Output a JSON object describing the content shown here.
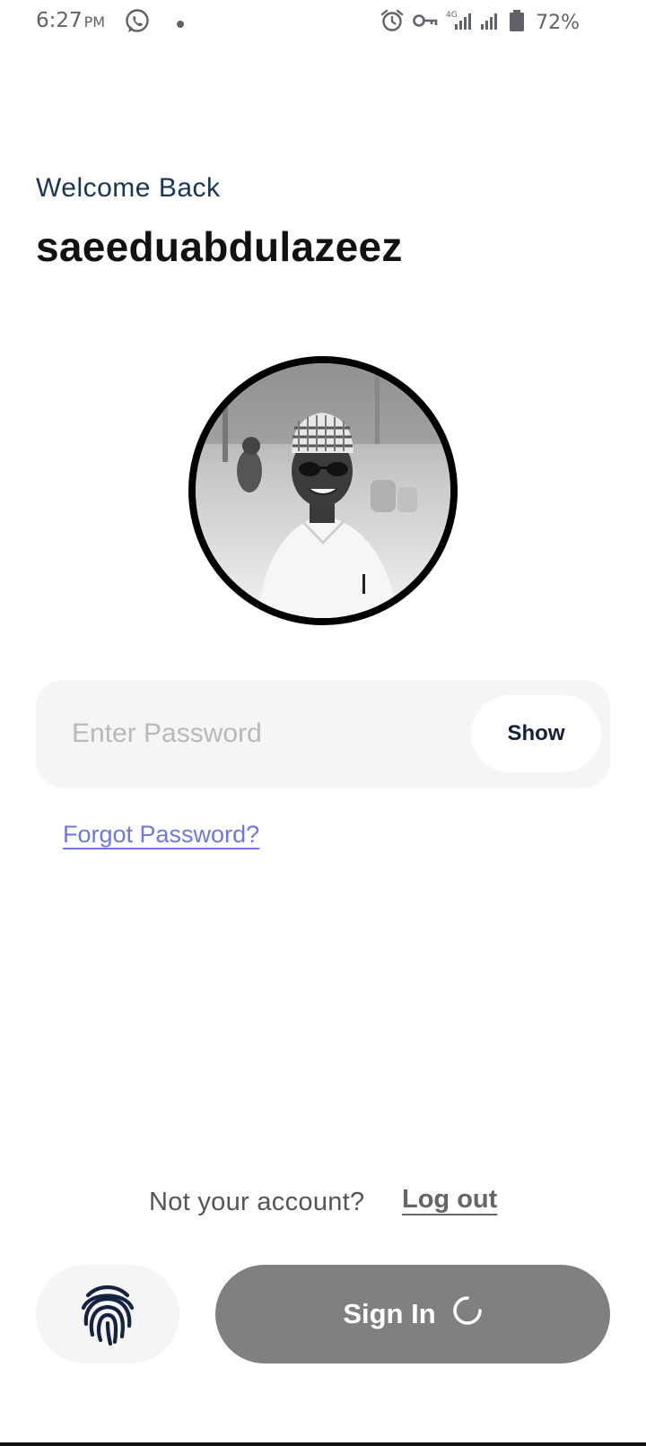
{
  "status_bar": {
    "time": "6:27",
    "ampm": "PM",
    "network": "4G",
    "battery": "72%",
    "icons": [
      "whatsapp-icon",
      "dot-icon",
      "alarm-icon",
      "vpn-key-icon",
      "signal-icon",
      "signal-icon",
      "battery-icon"
    ]
  },
  "header": {
    "welcome": "Welcome Back",
    "username": "saeeduabdulazeez"
  },
  "password": {
    "placeholder": "Enter Password",
    "value": "",
    "show_label": "Show"
  },
  "forgot_label": "Forgot Password?",
  "account": {
    "prompt": "Not your account?",
    "logout_label": "Log out"
  },
  "actions": {
    "fingerprint_icon": "fingerprint-icon",
    "signin_label": "Sign In",
    "signin_loading": true
  },
  "colors": {
    "accent_link": "#6f78e0",
    "navy": "#1a3558",
    "button_disabled": "#808080"
  }
}
